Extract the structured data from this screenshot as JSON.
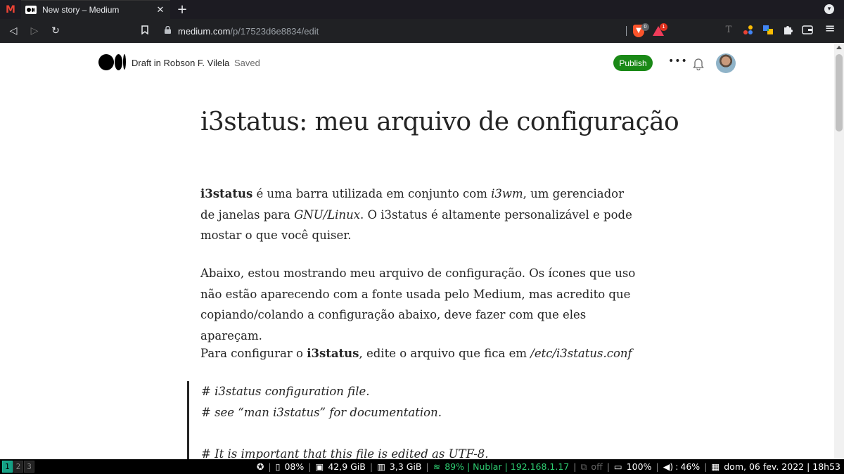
{
  "browser": {
    "pinned_tab_icon": "gmail-icon",
    "pinned_tab_letter": "M",
    "active_tab": {
      "title": "New story – Medium",
      "close": "✕"
    },
    "new_tab_label": "+",
    "url_host": "medium.com",
    "url_path": "/p/17523d6e8834/edit",
    "shield_badge": "0",
    "rewards_badge": "1",
    "extensions": [
      "translate-icon",
      "colorful-dots-icon",
      "color-squares-icon",
      "puzzle-icon",
      "wallet-icon",
      "menu-icon"
    ]
  },
  "medium": {
    "header": {
      "draft_label": "Draft in Robson F. Vilela",
      "saved_label": "Saved",
      "publish_label": "Publish",
      "more_label": "•••"
    },
    "article": {
      "title": "i3status: meu arquivo de configuração",
      "p1": {
        "bold": "i3status",
        "t1": " é uma barra utilizada em conjunto com ",
        "i1": "i3wm",
        "t2": ", um gerenciador de janelas para ",
        "i2": "GNU/Linux",
        "t3": ". O i3status é altamente personalizável e pode mostar o que você quiser."
      },
      "p2": "Abaixo, estou mostrando meu arquivo de configuração. Os ícones que uso não estão aparecendo com a fonte usada pelo Medium, mas acredito que copiando/colando a configuração abaixo, deve fazer com que eles apareçam.",
      "p3": {
        "t1": "Para configurar o ",
        "bold": "i3status",
        "t2": ", edite o arquivo que fica em ",
        "i1": "/etc/i3status.conf"
      },
      "quote_lines": [
        "# i3status configuration file.",
        "# see “man i3status” for documentation.",
        "",
        "# It is important that this file is edited as UTF-8."
      ]
    }
  },
  "i3bar": {
    "workspaces": [
      "1",
      "2",
      "3"
    ],
    "active_workspace": "1",
    "status": {
      "icon": "rebel-icon",
      "cpu": "08%",
      "disk": "42,9 GiB",
      "memory": "3,3 GiB",
      "wifi": "89% | Nublar | 192.168.1.17",
      "ethernet": "off",
      "battery": "100%",
      "volume": "46%",
      "volume_prefix": ":",
      "date": "dom, 06 fev. 2022 | 18h53"
    },
    "colors": {
      "wifi": "#2ecc71",
      "active_ws": "#16a085"
    }
  }
}
